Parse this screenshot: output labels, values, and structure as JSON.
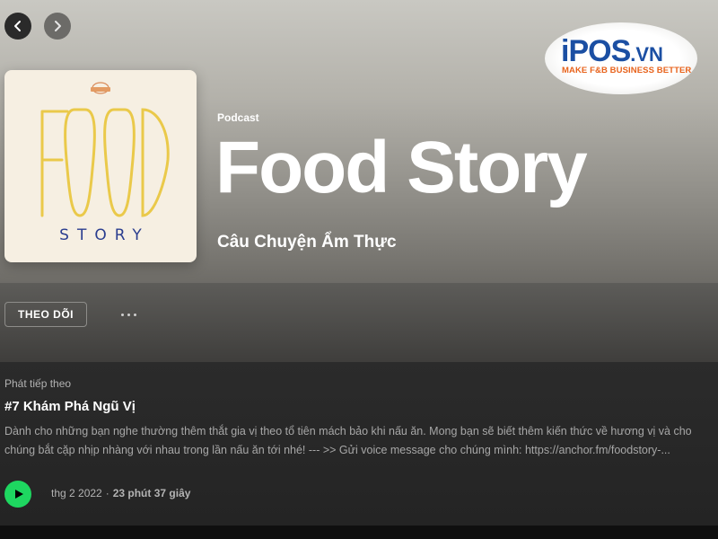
{
  "navigation": {
    "back_icon": "chevron-left-icon",
    "forward_icon": "chevron-right-icon"
  },
  "watermark": {
    "brand_main": "iPOS",
    "brand_suffix": ".VN",
    "tagline": "MAKE F&B BUSINESS BETTER",
    "brand_color": "#1b4fa3",
    "tagline_color": "#e8631c"
  },
  "podcast": {
    "type_label": "Podcast",
    "title": "Food Story",
    "subtitle": "Câu Chuyện Ẩm Thực",
    "cover": {
      "word_top": "FOOD",
      "word_bottom": "STORY",
      "accent_color": "#eac94a",
      "text_color": "#2a3d8f"
    }
  },
  "actions": {
    "follow_label": "THEO DÕI",
    "more_icon": "more-horizontal-icon"
  },
  "up_next": {
    "section_label": "Phát tiếp theo",
    "episode_title": "#7 Khám Phá Ngũ Vị",
    "description": "Dành cho những bạn nghe thường thêm thắt gia vị theo tổ tiên mách bảo khi nấu ăn. Mong bạn sẽ biết thêm kiến thức về hương vị và cho chúng bắt cặp nhịp nhàng với nhau trong lần nấu ăn tới nhé! --- >> Gửi voice message cho chúng mình: https://anchor.fm/foodstory-...",
    "date": "thg 2 2022",
    "separator": "·",
    "duration": "23 phút 37 giây",
    "play_icon": "play-icon",
    "play_color": "#1ed760"
  }
}
